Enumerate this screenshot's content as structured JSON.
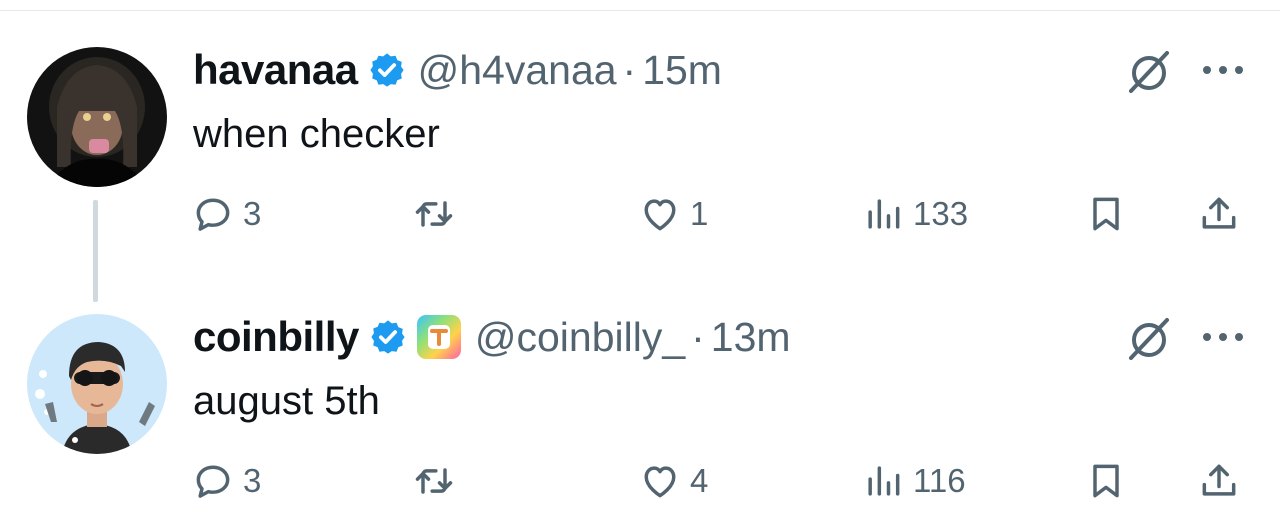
{
  "tweets": [
    {
      "name": "havanaa",
      "handle": "@h4vanaa",
      "separator": "·",
      "time": "15m",
      "text": "when checker",
      "verified": true,
      "affiliate_badge": false,
      "stats": {
        "replies": "3",
        "retweets": "",
        "likes": "1",
        "views": "133"
      },
      "icons": [
        "reply-icon",
        "retweet-icon",
        "like-icon",
        "views-icon",
        "bookmark-icon",
        "share-icon",
        "grok-icon",
        "more-icon"
      ]
    },
    {
      "name": "coinbilly",
      "handle": "@coinbilly_",
      "separator": "·",
      "time": "13m",
      "text": "august 5th",
      "verified": true,
      "affiliate_badge": true,
      "stats": {
        "replies": "3",
        "retweets": "",
        "likes": "4",
        "views": "116"
      },
      "icons": [
        "reply-icon",
        "retweet-icon",
        "like-icon",
        "views-icon",
        "bookmark-icon",
        "share-icon",
        "grok-icon",
        "more-icon"
      ]
    }
  ],
  "colors": {
    "text": "#0f1419",
    "secondary": "#536471",
    "verified_blue": "#1d9bf0",
    "thread_line": "#cfd9de"
  }
}
